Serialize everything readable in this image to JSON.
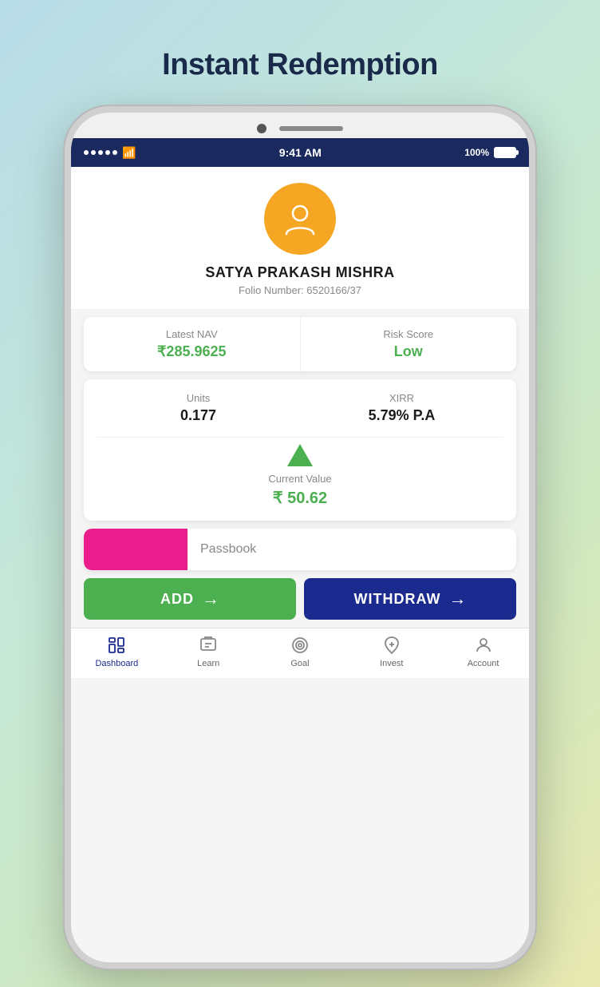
{
  "page": {
    "title": "Instant Redemption"
  },
  "status_bar": {
    "time": "9:41 AM",
    "battery": "100%"
  },
  "profile": {
    "name": "SATYA PRAKASH MISHRA",
    "folio": "Folio Number: 6520166/37",
    "avatar_label": "User Avatar"
  },
  "stats": {
    "nav_label": "Latest NAV",
    "nav_value": "₹285.9625",
    "risk_label": "Risk Score",
    "risk_value": "Low"
  },
  "investment": {
    "units_label": "Units",
    "units_value": "0.177",
    "xirr_label": "XIRR",
    "xirr_value": "5.79% P.A",
    "current_value_label": "Current Value",
    "current_value": "₹ 50.62"
  },
  "passbook": {
    "label": "Passbook"
  },
  "buttons": {
    "add_label": "ADD",
    "withdraw_label": "WITHDRAW"
  },
  "bottom_nav": {
    "items": [
      {
        "id": "dashboard",
        "label": "Dashboard"
      },
      {
        "id": "learn",
        "label": "Learn"
      },
      {
        "id": "goal",
        "label": "Goal"
      },
      {
        "id": "invest",
        "label": "Invest"
      },
      {
        "id": "account",
        "label": "Account"
      }
    ]
  }
}
